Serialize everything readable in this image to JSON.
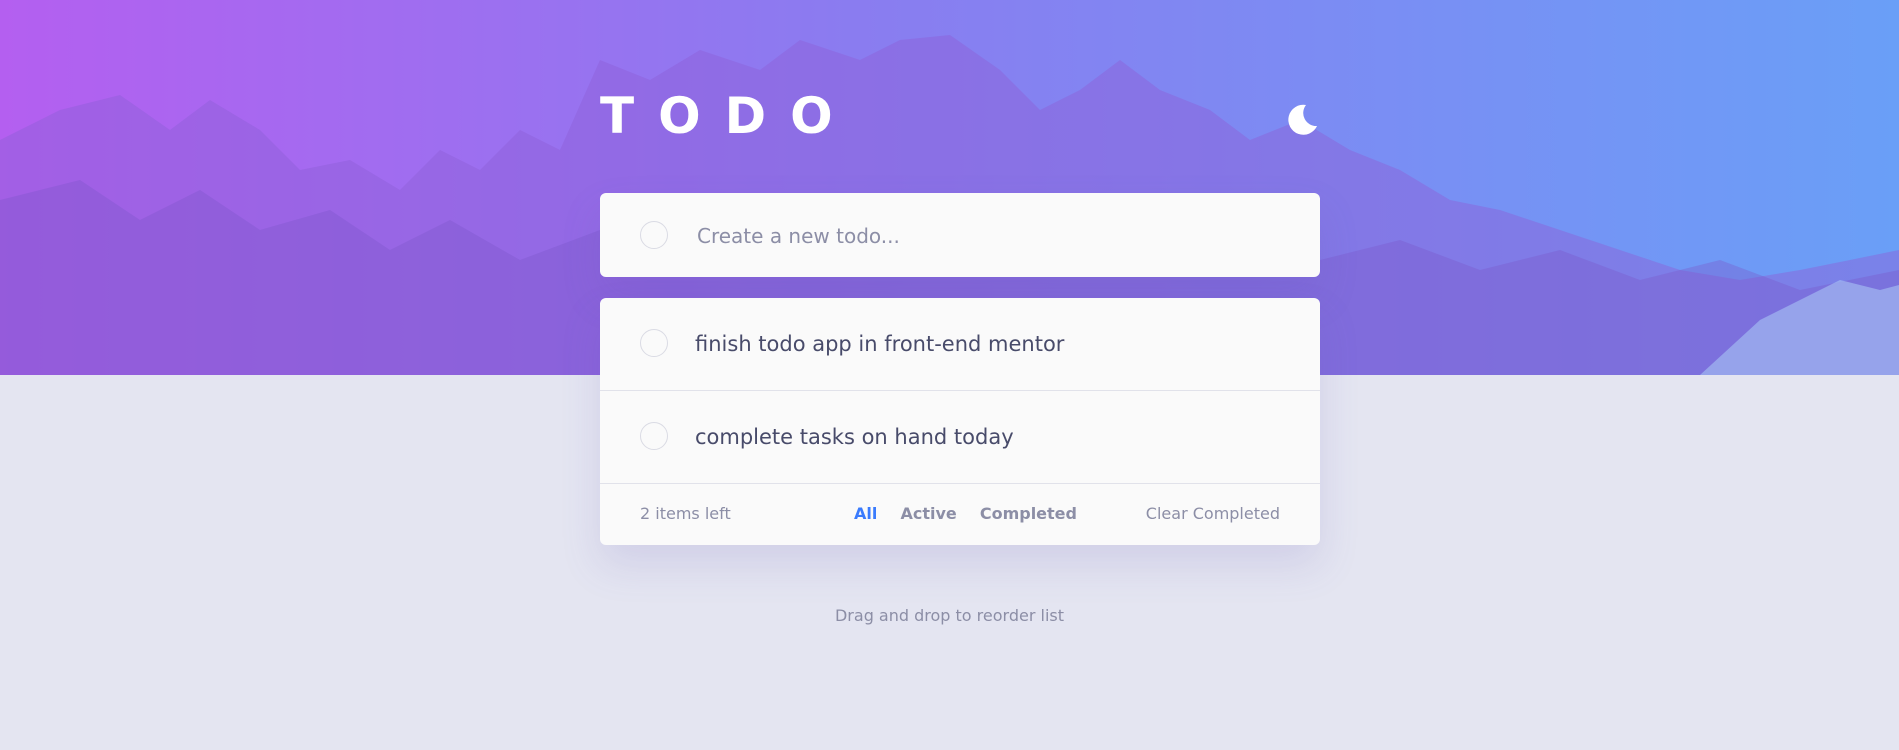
{
  "header": {
    "title": "TODO",
    "theme_icon": "moon-icon"
  },
  "new_todo": {
    "placeholder": "Create a new todo...",
    "value": ""
  },
  "todos": [
    {
      "text": "finish todo app in front-end mentor",
      "completed": false
    },
    {
      "text": "complete tasks on hand today",
      "completed": false
    }
  ],
  "footer": {
    "items_left": "2 items left",
    "filters": [
      "All",
      "Active",
      "Completed"
    ],
    "active_filter": "All",
    "clear_label": "Clear Completed"
  },
  "hint": "Drag and drop to reorder list",
  "colors": {
    "accent": "#3a7bfd",
    "page_bg": "#e4e5f1",
    "card_bg": "#fafafa",
    "text": "#484b6a",
    "muted": "#8c8ea6",
    "gradient_start": "#b45ff0",
    "gradient_end": "#6a9ff7"
  }
}
